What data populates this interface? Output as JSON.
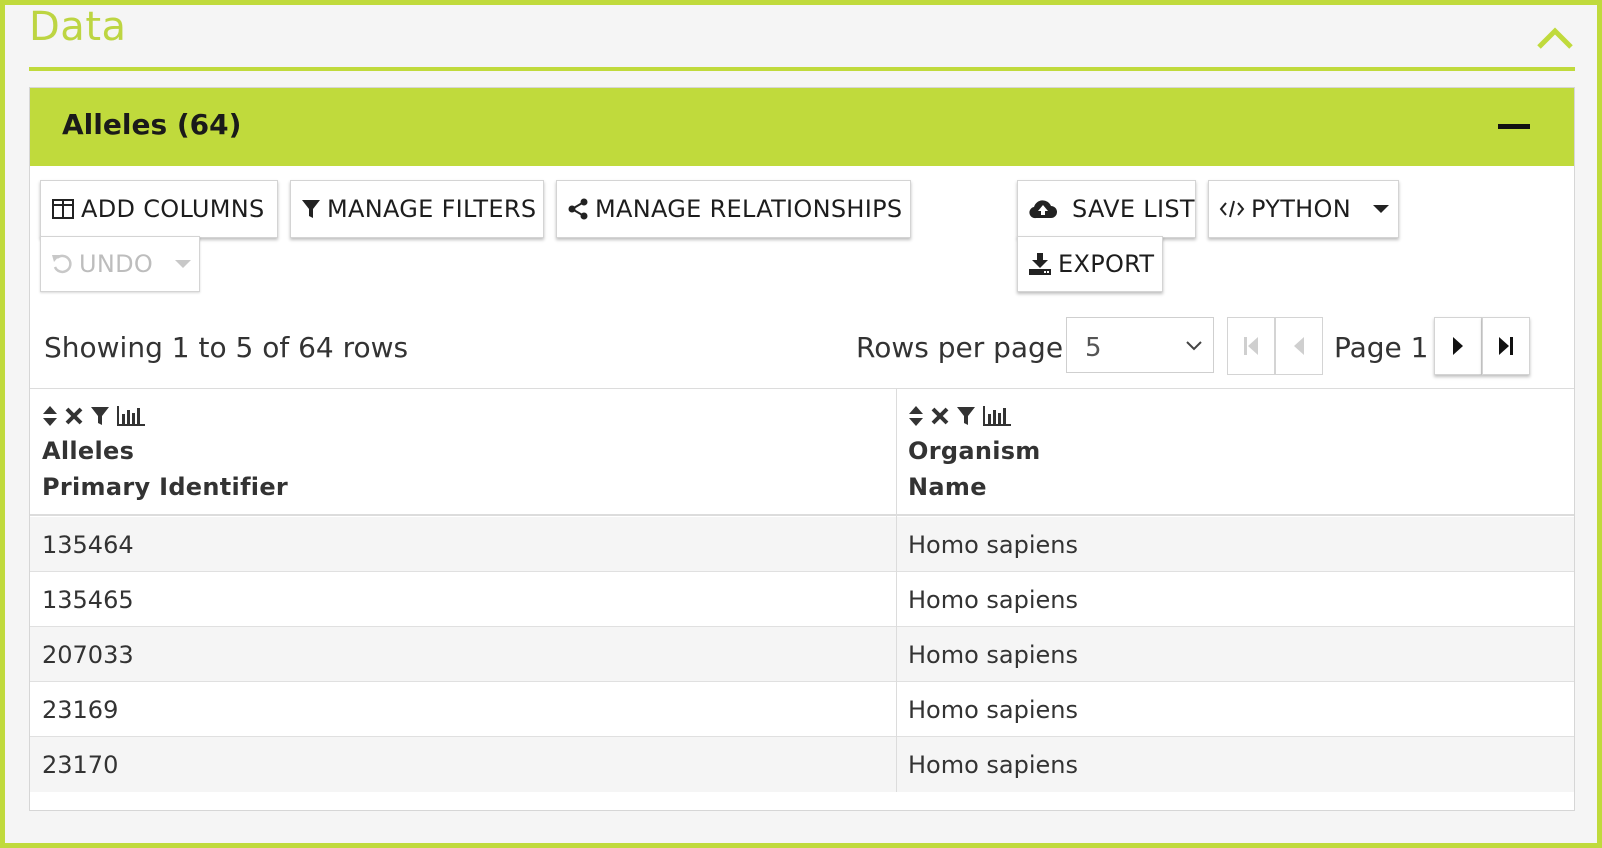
{
  "section": {
    "title": "Data"
  },
  "panel": {
    "title": "Alleles (64)"
  },
  "toolbar": {
    "add_columns": "ADD COLUMNS",
    "manage_filters": "MANAGE FILTERS",
    "manage_relationships": "MANAGE RELATIONSHIPS",
    "save_list": "SAVE LIST",
    "python": "PYTHON",
    "undo": "UNDO",
    "export": "EXPORT"
  },
  "pagination": {
    "showing": "Showing 1 to 5 of 64 rows",
    "rows_per_page_label": "Rows per page:",
    "rows_per_page_value": "5",
    "page_label": "Page 1"
  },
  "table": {
    "columns": [
      {
        "line1": "Alleles",
        "line2": "Primary Identifier"
      },
      {
        "line1": "Organism",
        "line2": "Name"
      }
    ],
    "rows": [
      [
        "135464",
        "Homo sapiens"
      ],
      [
        "135465",
        "Homo sapiens"
      ],
      [
        "207033",
        "Homo sapiens"
      ],
      [
        "23169",
        "Homo sapiens"
      ],
      [
        "23170",
        "Homo sapiens"
      ]
    ]
  },
  "colors": {
    "accent": "#c0da3c",
    "title_text": "#bdd542"
  },
  "icons": {
    "collapse": "chevron-up-icon",
    "panel_collapse": "minus-icon",
    "add_columns": "columns-icon",
    "filters": "filter-icon",
    "relationships": "share-icon",
    "save": "cloud-upload-icon",
    "python": "code-icon",
    "undo": "undo-icon",
    "export": "download-icon",
    "sort": "sort-icon",
    "remove": "close-icon",
    "summary": "bar-chart-icon"
  }
}
